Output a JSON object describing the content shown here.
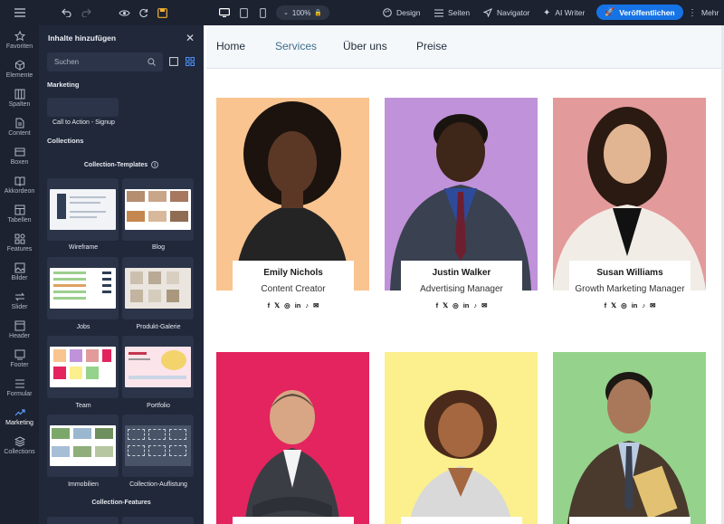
{
  "toolbar": {
    "zoom": "100%",
    "design": "Design",
    "pages": "Seiten",
    "navigator": "Navigator",
    "ai_writer": "AI Writer",
    "publish": "Veröffentlichen",
    "more": "Mehr"
  },
  "rail": {
    "items": [
      "Favoriten",
      "Elemente",
      "Spalten",
      "Content",
      "Boxen",
      "Akkordeon",
      "Tabellen",
      "Features",
      "Bilder",
      "Slider",
      "Header",
      "Footer",
      "Formular",
      "Marketing",
      "Collections"
    ]
  },
  "panel": {
    "title": "Inhalte hinzufügen",
    "search_placeholder": "Suchen",
    "marketing_label": "Marketing",
    "cta_label": "Call to Action - Signup",
    "collections_label": "Collections",
    "templates_label": "Collection-Templates",
    "features_label": "Collection-Features",
    "templates": [
      "Wireframe",
      "Blog",
      "Jobs",
      "Produkt-Galerie",
      "Team",
      "Portfolio",
      "Immobilien",
      "Collection-Auflistung"
    ]
  },
  "site": {
    "nav": [
      "Home",
      "Services",
      "Über uns",
      "Preise"
    ],
    "people": [
      {
        "name": "Emily Nichols",
        "role": "Content Creator"
      },
      {
        "name": "Justin Walker",
        "role": "Advertising Manager"
      },
      {
        "name": "Susan Williams",
        "role": "Growth Marketing Manager"
      }
    ],
    "social_icons": [
      "f",
      "𝕏",
      "◎",
      "in",
      "♪",
      "✉"
    ]
  },
  "colors": {
    "accent": "#1673e6",
    "card1_bg": "#f9c48f",
    "card2_bg": "#c092d9",
    "card3_bg": "#e39a9a",
    "card4_bg": "#e3245f",
    "card5_bg": "#fbef8e",
    "card6_bg": "#95d28b"
  }
}
